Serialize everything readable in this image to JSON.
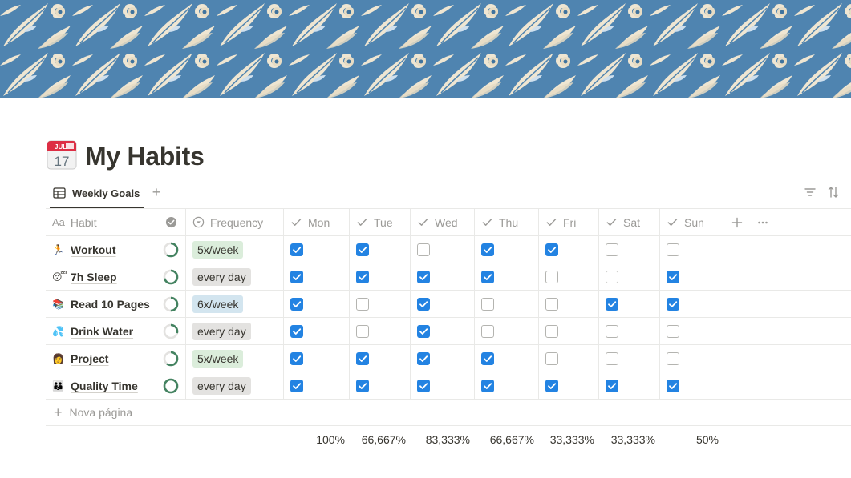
{
  "page": {
    "title": "My Habits",
    "icon": "calendar-icon",
    "icon_month": "JUL",
    "icon_day": "17"
  },
  "view": {
    "tab_label": "Weekly Goals",
    "add_view": "+"
  },
  "table": {
    "columns": {
      "habit": "Habit",
      "frequency": "Frequency",
      "mon": "Mon",
      "tue": "Tue",
      "wed": "Wed",
      "thu": "Thu",
      "fri": "Fri",
      "sat": "Sat",
      "sun": "Sun"
    },
    "habit_prefix": "Aa",
    "rows": [
      {
        "icon": "runner-icon",
        "emoji": "🏃",
        "name": "Workout",
        "progress": 0.6,
        "frequency": "5x/week",
        "freq_color": "#dbeddb",
        "days": [
          true,
          true,
          false,
          true,
          true,
          false,
          false
        ]
      },
      {
        "icon": "sleeping-face-icon",
        "emoji": "😴",
        "name": "7h Sleep",
        "progress": 0.71,
        "frequency": "every day",
        "freq_color": "#e3e2e0",
        "days": [
          true,
          true,
          true,
          true,
          false,
          false,
          true
        ]
      },
      {
        "icon": "books-icon",
        "emoji": "📚",
        "name": "Read 10 Pages",
        "progress": 0.5,
        "frequency": "6x/week",
        "freq_color": "#d3e5ef",
        "days": [
          true,
          false,
          true,
          false,
          false,
          true,
          true
        ]
      },
      {
        "icon": "droplets-icon",
        "emoji": "💦",
        "name": "Drink Water",
        "progress": 0.29,
        "frequency": "every day",
        "freq_color": "#e3e2e0",
        "days": [
          true,
          false,
          true,
          false,
          false,
          false,
          false
        ]
      },
      {
        "icon": "technologist-icon",
        "emoji": "👩",
        "name": "Project",
        "progress": 0.6,
        "frequency": "5x/week",
        "freq_color": "#dbeddb",
        "days": [
          true,
          true,
          true,
          true,
          false,
          false,
          false
        ]
      },
      {
        "icon": "family-icon",
        "emoji": "👪",
        "name": "Quality Time",
        "progress": 1.0,
        "frequency": "every day",
        "freq_color": "#e3e2e0",
        "days": [
          true,
          true,
          true,
          true,
          true,
          true,
          true
        ]
      }
    ],
    "new_row_label": "Nova página",
    "calculations": [
      "100%",
      "66,667%",
      "83,333%",
      "66,667%",
      "33,333%",
      "33,333%",
      "50%"
    ]
  },
  "colors": {
    "accent": "#2383e2",
    "progress_ring": "#448361",
    "cover_base": "#5d8fb8"
  }
}
